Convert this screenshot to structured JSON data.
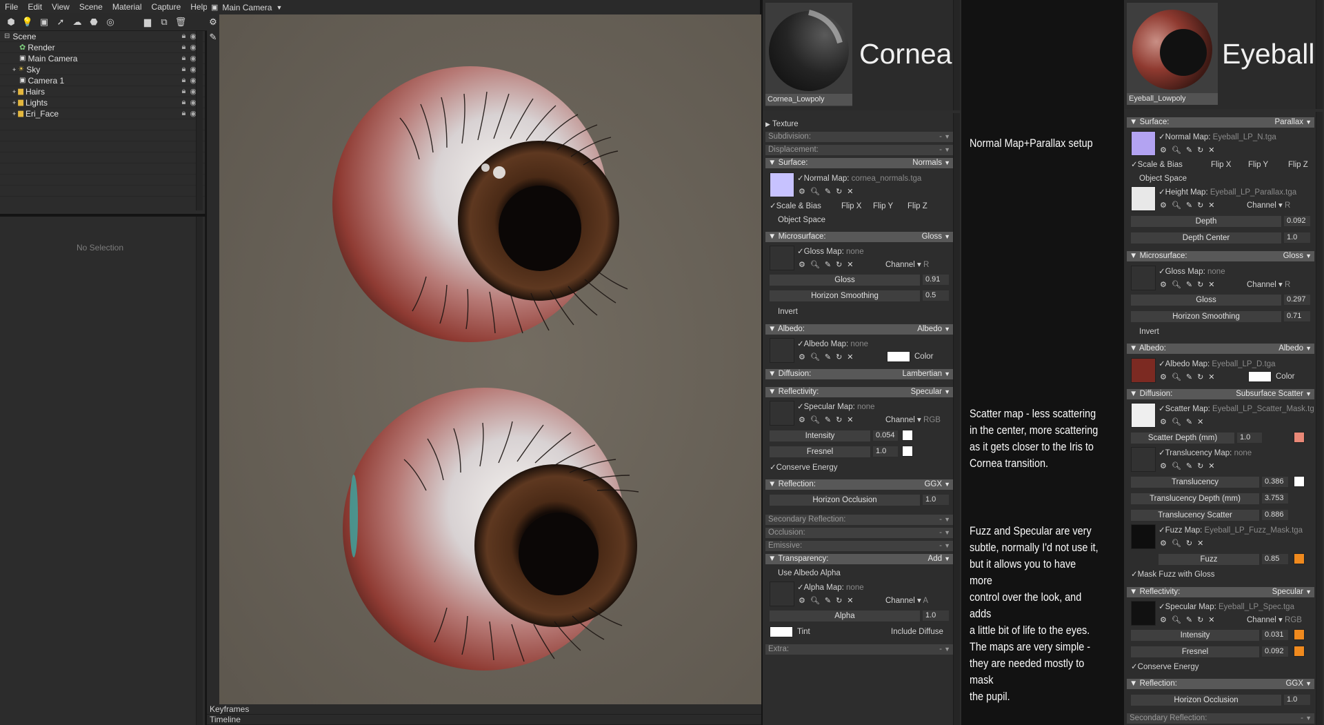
{
  "menu": [
    "File",
    "Edit",
    "View",
    "Scene",
    "Material",
    "Capture",
    "Help"
  ],
  "viewport": {
    "camera": "Main Camera",
    "keyframes": "Keyframes",
    "timeline": "Timeline"
  },
  "outliner": {
    "items": [
      "Scene",
      "Render",
      "Main Camera",
      "Sky",
      "Camera 1",
      "Hairs",
      "Lights",
      "Eri_Face"
    ]
  },
  "properties": {
    "empty": "No Selection"
  },
  "cornea": {
    "title": "Cornea",
    "material_label": "Cornea_Lowpoly",
    "texture": "Texture",
    "subdivision": "Subdivision:",
    "displacement": "Displacement:",
    "dash": "-",
    "surface": {
      "label": "Surface:",
      "mode": "Normals",
      "map_label": "Normal Map:",
      "map": "cornea_normals.tga",
      "scale_bias": "Scale & Bias",
      "flip_x": "Flip X",
      "flip_y": "Flip Y",
      "flip_z": "Flip Z",
      "object_space": "Object Space"
    },
    "microsurface": {
      "label": "Microsurface:",
      "mode": "Gloss",
      "map_label": "Gloss Map:",
      "map": "none",
      "channel": "Channel",
      "channel_val": "R",
      "gloss": "Gloss",
      "gloss_val": "0.91",
      "horizon": "Horizon Smoothing",
      "horizon_val": "0.5",
      "invert": "Invert"
    },
    "albedo": {
      "label": "Albedo:",
      "mode": "Albedo",
      "map_label": "Albedo Map:",
      "map": "none",
      "color": "Color"
    },
    "diffusion": {
      "label": "Diffusion:",
      "mode": "Lambertian"
    },
    "reflectivity": {
      "label": "Reflectivity:",
      "mode": "Specular",
      "map_label": "Specular Map:",
      "map": "none",
      "channel": "Channel",
      "channel_val": "RGB",
      "intensity": "Intensity",
      "intensity_val": "0.054",
      "fresnel": "Fresnel",
      "fresnel_val": "1.0",
      "conserve": "Conserve Energy"
    },
    "reflection": {
      "label": "Reflection:",
      "mode": "GGX",
      "horizon": "Horizon Occlusion",
      "horizon_val": "1.0"
    },
    "secondary": "Secondary Reflection:",
    "occlusion": "Occlusion:",
    "emissive": "Emissive:",
    "transparency": {
      "label": "Transparency:",
      "mode": "Add",
      "use_alpha": "Use Albedo Alpha",
      "map_label": "Alpha Map:",
      "map": "none",
      "channel": "Channel",
      "channel_val": "A",
      "alpha": "Alpha",
      "alpha_val": "1.0",
      "tint": "Tint",
      "include_diffuse": "Include Diffuse"
    },
    "extra": "Extra:"
  },
  "notes": {
    "normal": "Normal Map+Parallax setup",
    "scatter": [
      "Scatter map - less scattering",
      "in the center, more scattering",
      "as it gets closer to the Iris to",
      "Cornea transition."
    ],
    "fuzz": [
      "Fuzz and Specular are very",
      "subtle, normally I'd not use it,",
      "but it allows you to have more",
      "control over the look, and adds",
      "a little bit of life to the eyes.",
      "The maps are very simple -",
      "they are needed mostly to mask",
      "the pupil."
    ]
  },
  "eyeball": {
    "title": "Eyeball",
    "material_label": "Eyeball_Lowpoly",
    "surface": {
      "label": "Surface:",
      "mode": "Parallax",
      "map_label": "Normal Map:",
      "map": "Eyeball_LP_N.tga",
      "scale_bias": "Scale & Bias",
      "flip_x": "Flip X",
      "flip_y": "Flip Y",
      "flip_z": "Flip Z",
      "object_space": "Object Space",
      "height_label": "Height Map:",
      "height_map": "Eyeball_LP_Parallax.tga",
      "channel": "Channel",
      "channel_val": "R",
      "depth": "Depth",
      "depth_val": "0.092",
      "depth_center": "Depth Center",
      "depth_center_val": "1.0"
    },
    "microsurface": {
      "label": "Microsurface:",
      "mode": "Gloss",
      "map_label": "Gloss Map:",
      "map": "none",
      "channel": "Channel",
      "channel_val": "R",
      "gloss": "Gloss",
      "gloss_val": "0.297",
      "horizon": "Horizon Smoothing",
      "horizon_val": "0.71",
      "invert": "Invert"
    },
    "albedo": {
      "label": "Albedo:",
      "mode": "Albedo",
      "map_label": "Albedo Map:",
      "map": "Eyeball_LP_D.tga",
      "color": "Color"
    },
    "diffusion": {
      "label": "Diffusion:",
      "mode": "Subsurface Scatter",
      "scatter_label": "Scatter Map:",
      "scatter_map": "Eyeball_LP_Scatter_Mask.tg",
      "scatter_depth": "Scatter Depth (mm)",
      "scatter_depth_val": "1.0",
      "transl_label": "Translucency Map:",
      "transl_map": "none",
      "translucency": "Translucency",
      "translucency_val": "0.386",
      "transl_depth": "Translucency Depth (mm)",
      "transl_depth_val": "3.753",
      "transl_scatter": "Translucency Scatter",
      "transl_scatter_val": "0.886",
      "fuzz_label": "Fuzz Map:",
      "fuzz_map": "Eyeball_LP_Fuzz_Mask.tga",
      "fuzz": "Fuzz",
      "fuzz_val": "0.85",
      "mask_fuzz": "Mask Fuzz with Gloss"
    },
    "reflectivity": {
      "label": "Reflectivity:",
      "mode": "Specular",
      "map_label": "Specular Map:",
      "map": "Eyeball_LP_Spec.tga",
      "channel": "Channel",
      "channel_val": "RGB",
      "intensity": "Intensity",
      "intensity_val": "0.031",
      "fresnel": "Fresnel",
      "fresnel_val": "0.092",
      "conserve": "Conserve Energy"
    },
    "reflection": {
      "label": "Reflection:",
      "mode": "GGX",
      "horizon": "Horizon Occlusion",
      "horizon_val": "1.0"
    },
    "secondary": "Secondary Reflection:",
    "dash": "-"
  },
  "colors": {
    "accent_orange": "#f08a1e",
    "salmon": "#e98877",
    "lavender": "#c8c3ff",
    "viewport_bg": "#6a645a"
  }
}
